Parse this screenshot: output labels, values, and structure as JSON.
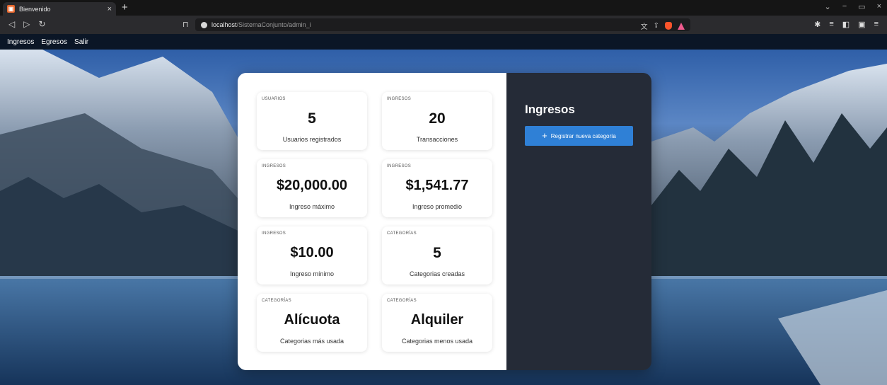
{
  "browser": {
    "tab_title": "Bienvenido",
    "tab_close": "×",
    "new_tab": "+",
    "url_host": "localhost",
    "url_path": "/SistemaConjunto/admin_i",
    "win_minimize": "−",
    "win_restore": "▭",
    "win_close": "×"
  },
  "nav": {
    "items": [
      "Ingresos",
      "Egresos",
      "Salir"
    ]
  },
  "cards": [
    {
      "label": "USUARIOS",
      "value": "5",
      "desc": "Usuarios registrados"
    },
    {
      "label": "INGRESOS",
      "value": "20",
      "desc": "Transacciones"
    },
    {
      "label": "INGRESOS",
      "value": "$20,000.00",
      "desc": "Ingreso máximo"
    },
    {
      "label": "INGRESOS",
      "value": "$1,541.77",
      "desc": "Ingreso promedio"
    },
    {
      "label": "INGRESOS",
      "value": "$10.00",
      "desc": "Ingreso mínimo"
    },
    {
      "label": "CATEGORÍAS",
      "value": "5",
      "desc": "Categorias creadas"
    },
    {
      "label": "CATEGORÍAS",
      "value": "Alícuota",
      "desc": "Categorias más usada"
    },
    {
      "label": "CATEGORÍAS",
      "value": "Alquiler",
      "desc": "Categorias menos usada"
    }
  ],
  "side": {
    "title": "Ingresos",
    "button_label": "Registrar nueva categoría"
  },
  "colors": {
    "accent": "#2f80d6",
    "side_bg": "#252b37",
    "nav_bg": "#0b1626"
  }
}
